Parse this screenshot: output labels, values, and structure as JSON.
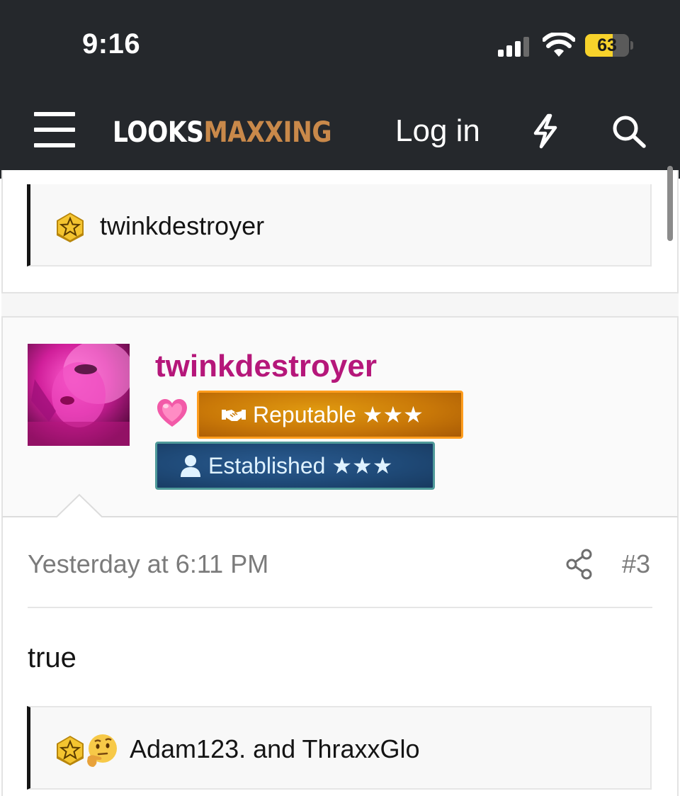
{
  "status_bar": {
    "time": "9:16",
    "battery_percent": "63",
    "battery_level": 0.63,
    "icons": [
      "signal-icon",
      "wifi-icon",
      "battery-icon"
    ]
  },
  "header": {
    "logo_part1": "LOOKS",
    "logo_part2": "MAXXING",
    "login_label": "Log in",
    "icons": [
      "menu-icon",
      "bolt-icon",
      "search-icon"
    ],
    "colors": {
      "background": "#25282c",
      "logo_accent": "#c9894a"
    }
  },
  "previous_post": {
    "reactions_text": "twinkdestroyer",
    "reaction_icons": [
      "star-reaction-icon"
    ]
  },
  "post": {
    "author": {
      "username": "twinkdestroyer",
      "username_color": "#b5177a",
      "flair_icon": "pink-heart-icon",
      "badges": [
        {
          "label": "Reputable ★★★",
          "icon": "handshake-icon",
          "color": "#c97808"
        },
        {
          "label": "Established ★★★",
          "icon": "user-icon",
          "color": "#1f4a78"
        }
      ]
    },
    "date": "Yesterday at 6:11 PM",
    "number": "#3",
    "share_icon": "share-icon",
    "body": "true",
    "reactions_text": "Adam123. and ThraxxGlo",
    "reaction_icons": [
      "star-reaction-icon",
      "thinking-face-icon"
    ]
  }
}
